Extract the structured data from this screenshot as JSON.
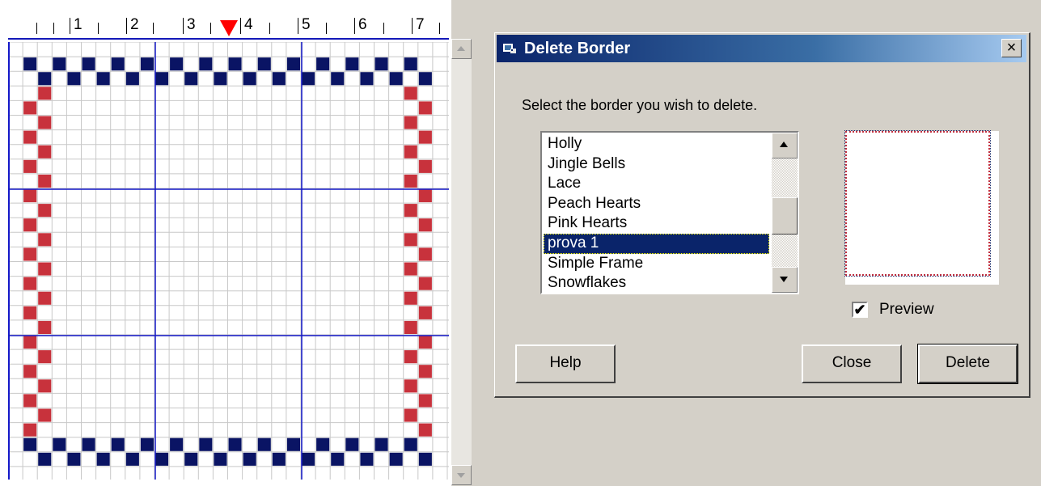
{
  "ruler": {
    "labels": [
      "1",
      "2",
      "3",
      "4",
      "5",
      "6",
      "7"
    ]
  },
  "grid": {
    "checker_dark": "#0a1464",
    "checker_red": "#c8323c",
    "major_line_color": "#1418c8",
    "minor_line_color": "#c8c8c8"
  },
  "dialog": {
    "title": "Delete Border",
    "close_glyph": "×",
    "prompt": "Select the border you wish to delete.",
    "list": {
      "items": [
        "Holly",
        "Jingle Bells",
        "Lace",
        "Peach Hearts",
        "Pink Hearts",
        "prova 1",
        "Simple Frame",
        "Snowflakes"
      ],
      "selected": "prova 1"
    },
    "preview": {
      "label": "Preview",
      "checked": true,
      "check_glyph": "✔"
    },
    "buttons": {
      "help": "Help",
      "close": "Close",
      "delete": "Delete"
    }
  },
  "colors": {
    "title_gradient_start": "#0a246a",
    "face": "#d4d0c8",
    "selection": "#0a246a"
  }
}
